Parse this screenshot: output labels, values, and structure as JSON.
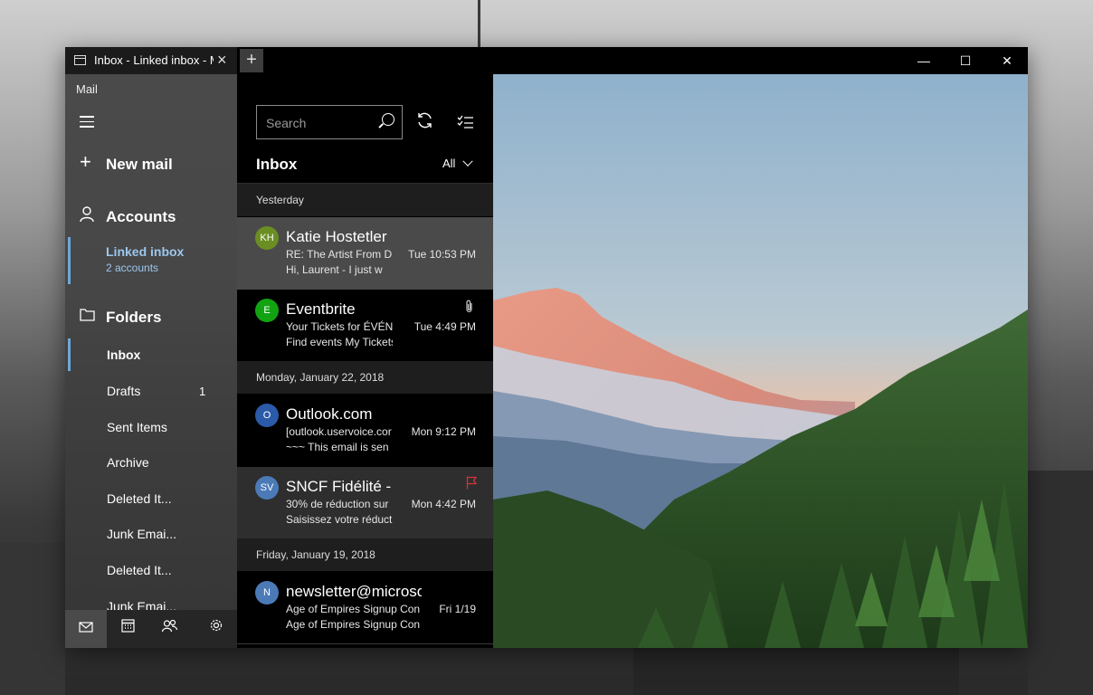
{
  "window": {
    "tab_title": "Inbox - Linked inbox - Mail",
    "new_tab_symbol": "+",
    "minimize_symbol": "—",
    "maximize_symbol": "☐",
    "close_symbol": "✕"
  },
  "nav": {
    "app_label": "Mail",
    "new_mail": "New mail",
    "accounts": "Accounts",
    "linked_inbox_title": "Linked inbox",
    "linked_inbox_sub": "2 accounts",
    "folders_label": "Folders",
    "folders": [
      {
        "name": "Inbox",
        "count": ""
      },
      {
        "name": "Drafts",
        "count": "1"
      },
      {
        "name": "Sent Items",
        "count": ""
      },
      {
        "name": "Archive",
        "count": ""
      },
      {
        "name": "Deleted It...",
        "count": ""
      },
      {
        "name": "Junk Emai...",
        "count": ""
      },
      {
        "name": "Deleted It...",
        "count": ""
      },
      {
        "name": "Junk Emai...",
        "count": ""
      }
    ],
    "bottom_icons": [
      "mail-icon",
      "calendar-icon",
      "people-icon",
      "settings-icon"
    ]
  },
  "list": {
    "search_placeholder": "Search",
    "title": "Inbox",
    "filter": "All",
    "groups": [
      {
        "date": "Yesterday",
        "messages": [
          {
            "initials": "KH",
            "avatar_color": "#6b8e23",
            "sender": "Katie Hostetler",
            "subject": "RE: The Artist From DI",
            "preview": "Hi, Laurent -     I just w",
            "time": "Tue 10:53 PM"
          },
          {
            "initials": "E",
            "avatar_color": "#12a312",
            "sender": "Eventbrite",
            "subject": "Your Tickets for ÉVÉNE",
            "preview": "Find events My Tickets",
            "time": "Tue 4:49 PM",
            "attachment": true
          }
        ]
      },
      {
        "date": "Monday, January 22, 2018",
        "messages": [
          {
            "initials": "O",
            "avatar_color": "#2b5aa8",
            "sender": "Outlook.com",
            "subject": "[outlook.uservoice.cor",
            "preview": "~~~ This email is sen",
            "time": "Mon 9:12 PM"
          },
          {
            "initials": "SV",
            "avatar_color": "#4b7ab7",
            "sender": "SNCF Fidélité - F",
            "subject": "30% de réduction sur",
            "preview": "Saisissez votre réducti",
            "time": "Mon 4:42 PM",
            "flagged": true
          }
        ]
      },
      {
        "date": "Friday, January 19, 2018",
        "messages": [
          {
            "initials": "N",
            "avatar_color": "#4b7ab7",
            "sender": "newsletter@microso",
            "subject": "Age of Empires Signup Con",
            "preview": "Age of Empires Signup Con",
            "time": "Fri 1/19"
          }
        ]
      }
    ]
  },
  "colors": {
    "accent": "#6ea7d9",
    "flag": "#d13438"
  }
}
